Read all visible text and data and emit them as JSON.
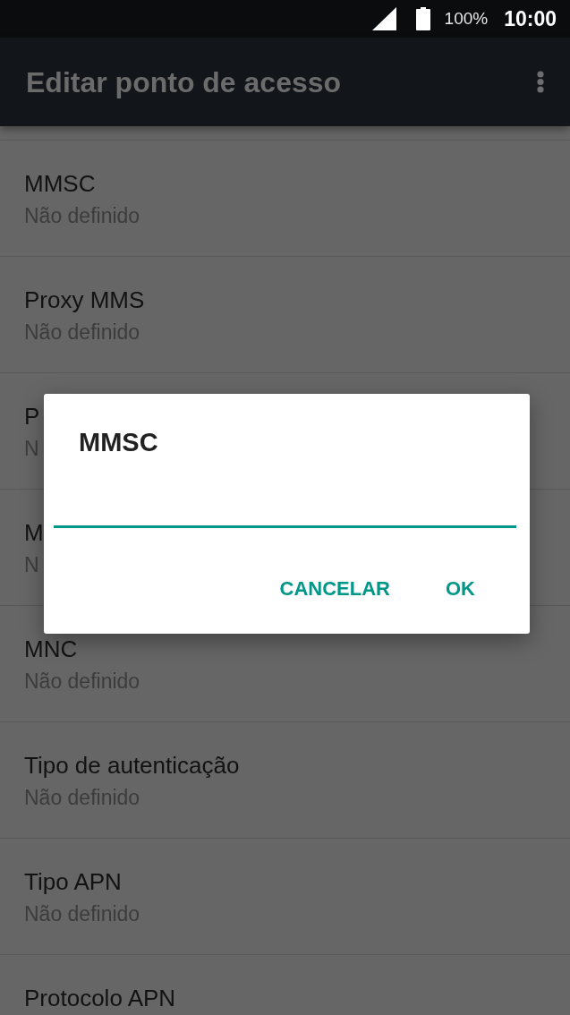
{
  "status_bar": {
    "battery": "100%",
    "time": "10:00"
  },
  "toolbar": {
    "title": "Editar ponto de acesso"
  },
  "settings": [
    {
      "title": "MMSC",
      "value": "Não definido"
    },
    {
      "title": "Proxy MMS",
      "value": "Não definido"
    },
    {
      "title": "P",
      "value": "N"
    },
    {
      "title": "M",
      "value": "N"
    },
    {
      "title": "MNC",
      "value": "Não definido"
    },
    {
      "title": "Tipo de autenticação",
      "value": "Não definido"
    },
    {
      "title": "Tipo APN",
      "value": "Não definido"
    },
    {
      "title": "Protocolo APN"
    }
  ],
  "dialog": {
    "title": "MMSC",
    "field": {
      "focused": true
    },
    "buttons": [
      {
        "label": "CANCELAR"
      },
      {
        "label": "OK"
      }
    ]
  }
}
